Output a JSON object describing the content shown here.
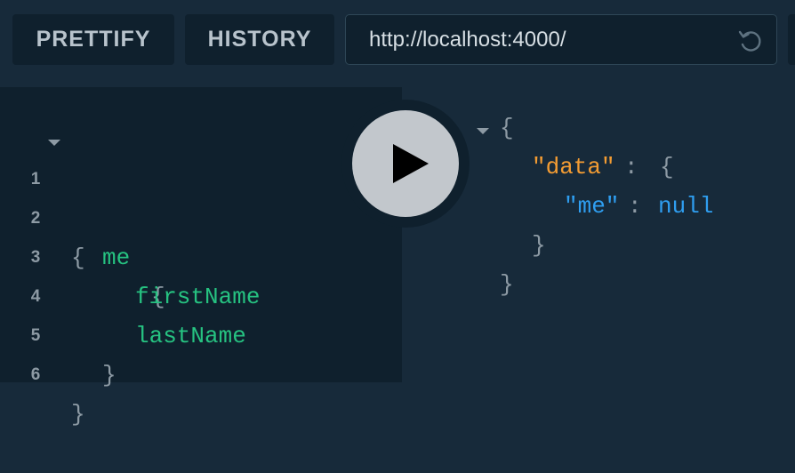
{
  "toolbar": {
    "prettify_label": "PRETTIFY",
    "history_label": "HISTORY",
    "endpoint_url": "http://localhost:4000/",
    "reload_icon": "reload-icon"
  },
  "editor": {
    "lines": [
      {
        "number": "1",
        "text": "{"
      },
      {
        "number": "2",
        "field": "me",
        "brace": "{"
      },
      {
        "number": "3",
        "field": "firstName"
      },
      {
        "number": "4",
        "field": "lastName"
      },
      {
        "number": "5",
        "text": "}"
      },
      {
        "number": "6",
        "text": "}"
      }
    ]
  },
  "result": {
    "open": "{",
    "data_key": "\"data\"",
    "colon": ":",
    "data_open": "{",
    "me_key": "\"me\"",
    "me_value": "null",
    "data_close": "}",
    "close": "}"
  },
  "execute": {
    "icon": "play-icon"
  },
  "colors": {
    "background": "#172a3a",
    "editor_background": "#0f202d",
    "field": "#26c281",
    "string_key": "#f39c33",
    "null_value": "#2f9ef0"
  }
}
